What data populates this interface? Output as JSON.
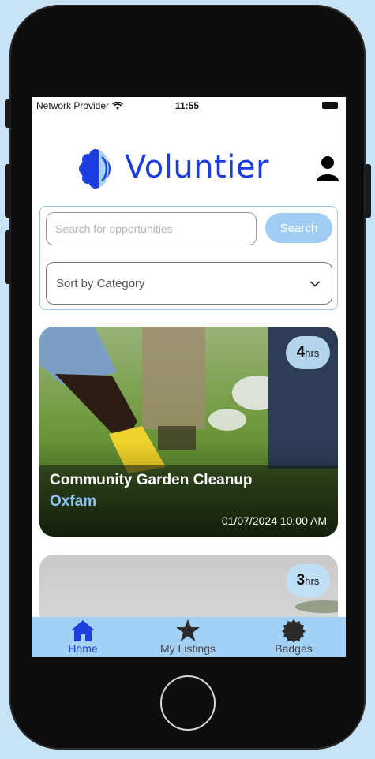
{
  "status_bar": {
    "carrier": "Network Provider",
    "time": "11:55"
  },
  "app": {
    "name": "Voluntier"
  },
  "search": {
    "placeholder": "Search for opportunities",
    "value": "",
    "button_label": "Search"
  },
  "sort": {
    "placeholder": "Sort by Category"
  },
  "listings": [
    {
      "title": "Community Garden Cleanup",
      "organization": "Oxfam",
      "datetime": "01/07/2024 10:00 AM",
      "hours": "4",
      "hours_unit": "hrs"
    },
    {
      "hours": "3",
      "hours_unit": "hrs"
    }
  ],
  "tabbar": {
    "home": "Home",
    "my_listings": "My Listings",
    "badges": "Badges"
  },
  "icons": {
    "logo": "voluntier-logo-icon",
    "profile": "person-icon",
    "chevron": "chevron-down-icon",
    "home": "home-icon",
    "listings": "star-icon",
    "badges": "badge-icon",
    "wifi": "wifi-icon"
  },
  "colors": {
    "brand": "#1b3de0",
    "accent": "#a3d0f5",
    "org": "#8cc6f5",
    "background": "#c9e3f6"
  }
}
